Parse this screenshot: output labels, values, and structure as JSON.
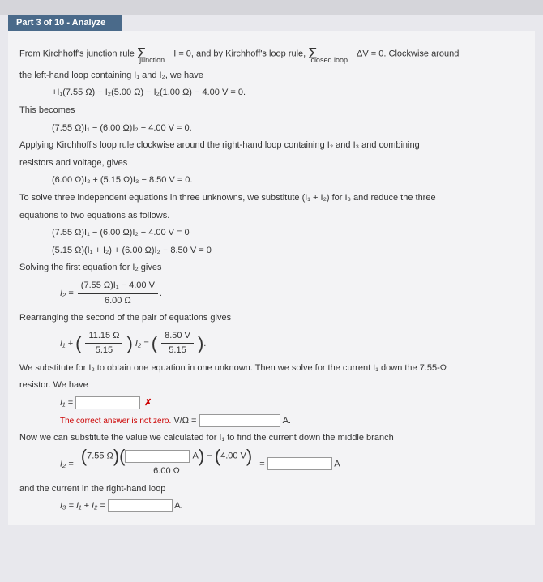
{
  "header": "Part 3 of 10 - Analyze",
  "p1a": "From Kirchhoff's junction rule",
  "p1b": "I = 0, and by Kirchhoff's loop rule,",
  "p1c": "ΔV = 0. Clockwise around",
  "sub_junction": "junction",
  "sub_closed": "closed loop",
  "p2": "the left-hand loop containing I₁ and I₂, we have",
  "eq1": "+I₁(7.55 Ω) − I₂(5.00 Ω) − I₂(1.00 Ω) − 4.00 V = 0.",
  "p3": "This becomes",
  "eq2": "(7.55 Ω)I₁ − (6.00 Ω)I₂ − 4.00 V = 0.",
  "p4": "Applying Kirchhoff's loop rule clockwise around the right-hand loop containing I₂ and I₃ and combining",
  "p5": "resistors and voltage, gives",
  "eq3": "(6.00 Ω)I₂ + (5.15 Ω)I₃ − 8.50 V = 0.",
  "p6": "To solve three independent equations in three unknowns, we substitute  (I₁ + I₂)  for I₃ and reduce the three",
  "p7": "equations to two equations as follows.",
  "eq4": "(7.55 Ω)I₁ − (6.00 Ω)I₂ − 4.00 V = 0",
  "eq5": "(5.15 Ω)(I₁ + I₂) + (6.00 Ω)I₂ − 8.50 V = 0",
  "p8": "Solving the first equation for I₂ gives",
  "eq6_lhs": "I₂ = ",
  "eq6_num": "(7.55 Ω)I₁ − 4.00 V",
  "eq6_den": "6.00 Ω",
  "p9": "Rearranging the second of the pair of equations gives",
  "eq7_lhs": "I₁ + ",
  "eq7_f1num": "11.15 Ω",
  "eq7_f1den": "5.15",
  "eq7_mid": "I₂ = ",
  "eq7_f2num": "8.50 V",
  "eq7_f2den": "5.15",
  "p10": "We substitute for I₂ to obtain one equation in one unknown. Then we solve for the current I₁ down the 7.55-Ω",
  "p11": "resistor. We have",
  "i1_label": "I₁ = ",
  "err_msg": "The correct answer is not zero.",
  "unit1": " V/Ω = ",
  "unit_A": "A.",
  "p12": "Now we can substitute the value we calculated for I₁ to find the current down the middle branch",
  "i2_label": "I₂ = ",
  "i2_num_pre": "7.55 Ω",
  "i2_num_mid": "A",
  "i2_minus": " − ",
  "i2_v": "4.00 V",
  "i2_den": "6.00 Ω",
  "i2_eq": " = ",
  "unit_A2": "A",
  "p13": "and the current in the right-hand loop",
  "i3_label": "I₃ = I₁ + I₂ = ",
  "sigma": "Σ"
}
